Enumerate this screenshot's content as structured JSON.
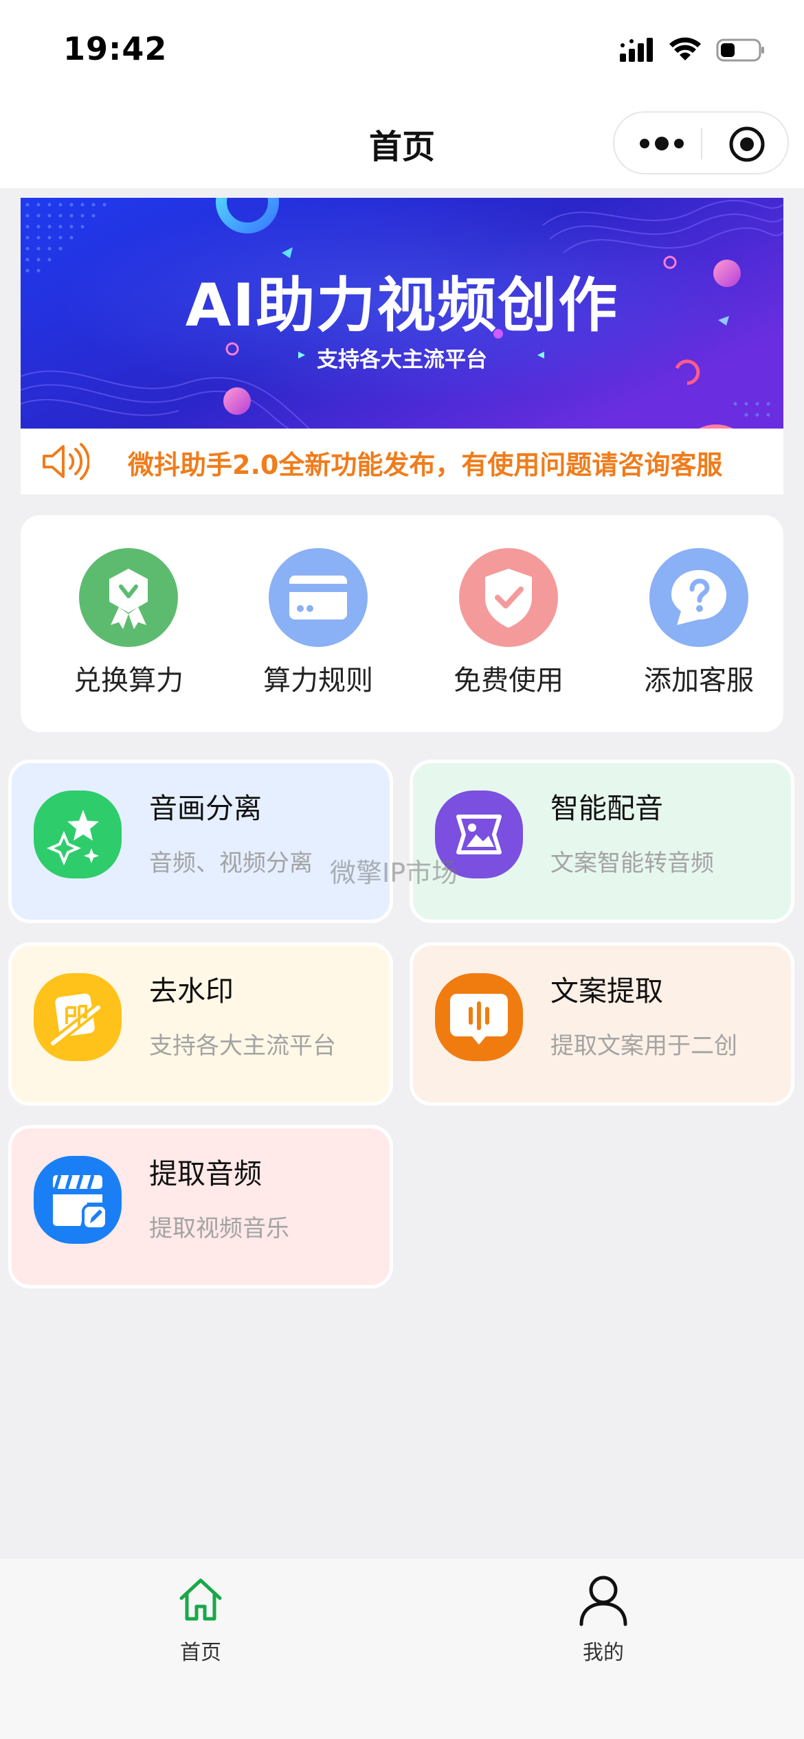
{
  "status": {
    "time": "19:42"
  },
  "nav": {
    "title": "首页"
  },
  "banner": {
    "title": "AI助力视频创作",
    "subtitle": "支持各大主流平台"
  },
  "notice": {
    "text": "微抖助手2.0全新功能发布，有使用问题请咨询客服"
  },
  "quick_actions": [
    {
      "label": "兑换算力",
      "icon": "ribbon-badge-icon",
      "color": "#5dbb6f"
    },
    {
      "label": "算力规则",
      "icon": "card-icon",
      "color": "#8ab0f5"
    },
    {
      "label": "免费使用",
      "icon": "shield-check-icon",
      "color": "#f49a9a"
    },
    {
      "label": "添加客服",
      "icon": "help-bubble-icon",
      "color": "#8ab0f5"
    }
  ],
  "tools": [
    {
      "title": "音画分离",
      "desc": "音频、视频分离",
      "bg": "#e5efff",
      "icon": "sparkle-star-icon",
      "icon_color": "#2ecc6b"
    },
    {
      "title": "智能配音",
      "desc": "文案智能转音频",
      "bg": "#e6f7ee",
      "icon": "image-frame-icon",
      "icon_color": "#7b4fe0"
    },
    {
      "title": "去水印",
      "desc": "支持各大主流平台",
      "bg": "#fff8e6",
      "icon": "erase-stamp-icon",
      "icon_color": "#ffc21a"
    },
    {
      "title": "文案提取",
      "desc": "提取文案用于二创",
      "bg": "#fdf0e6",
      "icon": "voice-bubble-icon",
      "icon_color": "#f07c10"
    },
    {
      "title": "提取音频",
      "desc": "提取视频音乐",
      "bg": "#ffe9e9",
      "icon": "clapper-edit-icon",
      "icon_color": "#1a7ff5"
    }
  ],
  "watermark": "微擎IP市场",
  "tabbar": [
    {
      "label": "首页",
      "icon": "home-icon",
      "active": true
    },
    {
      "label": "我的",
      "icon": "user-icon",
      "active": false
    }
  ]
}
